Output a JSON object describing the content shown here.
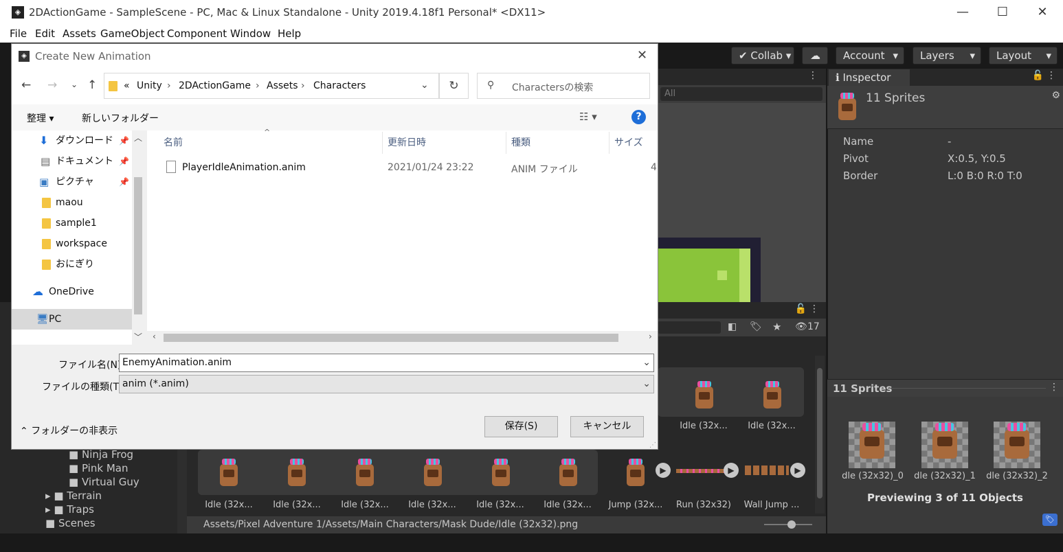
{
  "window": {
    "title": "2DActionGame - SampleScene - PC, Mac & Linux Standalone - Unity 2019.4.18f1 Personal* <DX11>",
    "minimize": "—",
    "maximize": "☐",
    "close": "✕"
  },
  "menu": [
    "File",
    "Edit",
    "Assets",
    "GameObject",
    "Component",
    "Window",
    "Help"
  ],
  "toolbar": {
    "collab": "Collab",
    "account": "Account",
    "layers": "Layers",
    "layout": "Layout"
  },
  "scene": {
    "search_placeholder": "All"
  },
  "inspector": {
    "tab": "Inspector",
    "header": "11 Sprites",
    "rows": [
      {
        "label": "Name",
        "value": "-"
      },
      {
        "label": "Pivot",
        "value": "X:0.5, Y:0.5"
      },
      {
        "label": "Border",
        "value": "L:0 B:0 R:0 T:0"
      }
    ],
    "preview_title": "11 Sprites",
    "previews": [
      "dle (32x32)_0",
      "dle (32x32)_1",
      "dle (32x32)_2"
    ],
    "preview_caption": "Previewing 3 of 11 Objects"
  },
  "project": {
    "hidden_count": "17",
    "tree": [
      "Ninja Frog",
      "Pink Man",
      "Virtual Guy",
      "Terrain",
      "Traps",
      "Scenes"
    ],
    "row1_labels": [
      "Idle (32x...",
      "Idle (32x..."
    ],
    "row2_labels": [
      "Idle (32x...",
      "Idle (32x...",
      "Idle (32x...",
      "Idle (32x...",
      "Idle (32x...",
      "Idle (32x...",
      "Jump (32x...",
      "Run (32x32)",
      "Wall Jump ..."
    ],
    "path": "Assets/Pixel Adventure 1/Assets/Main Characters/Mask Dude/Idle (32x32).png"
  },
  "dialog": {
    "title": "Create New Animation",
    "breadcrumb": [
      "«",
      "Unity",
      "2DActionGame",
      "Assets",
      "Characters"
    ],
    "search_placeholder": "Charactersの検索",
    "organize": "整理 ▾",
    "new_folder": "新しいフォルダー",
    "help": "?",
    "nav_items": [
      {
        "label": "ダウンロード",
        "icon": "download-icon"
      },
      {
        "label": "ドキュメント",
        "icon": "document-icon"
      },
      {
        "label": "ピクチャ",
        "icon": "picture-icon"
      },
      {
        "label": "maou",
        "icon": "folder-icon"
      },
      {
        "label": "sample1",
        "icon": "folder-icon"
      },
      {
        "label": "workspace",
        "icon": "folder-icon"
      },
      {
        "label": "おにぎり",
        "icon": "folder-icon"
      },
      {
        "label": "OneDrive",
        "icon": "cloud-icon"
      },
      {
        "label": "PC",
        "icon": "pc-icon"
      }
    ],
    "columns": [
      "名前",
      "更新日時",
      "種類",
      "サイズ"
    ],
    "files": [
      {
        "name": "PlayerIdleAnimation.anim",
        "date": "2021/01/24 23:22",
        "type": "ANIM ファイル",
        "size": "4"
      }
    ],
    "filename_label": "ファイル名(N):",
    "filename_value": "EnemyAnimation.anim",
    "filetype_label": "ファイルの種類(T):",
    "filetype_value": "anim (*.anim)",
    "hide_folders": "フォルダーの非表示",
    "save": "保存(S)",
    "cancel": "キャンセル"
  },
  "colors": {
    "unity_dark": "#282828",
    "inspector_bg": "#383838",
    "dialog_bg": "#f0f0f0",
    "help_blue": "#1e6ed8"
  }
}
